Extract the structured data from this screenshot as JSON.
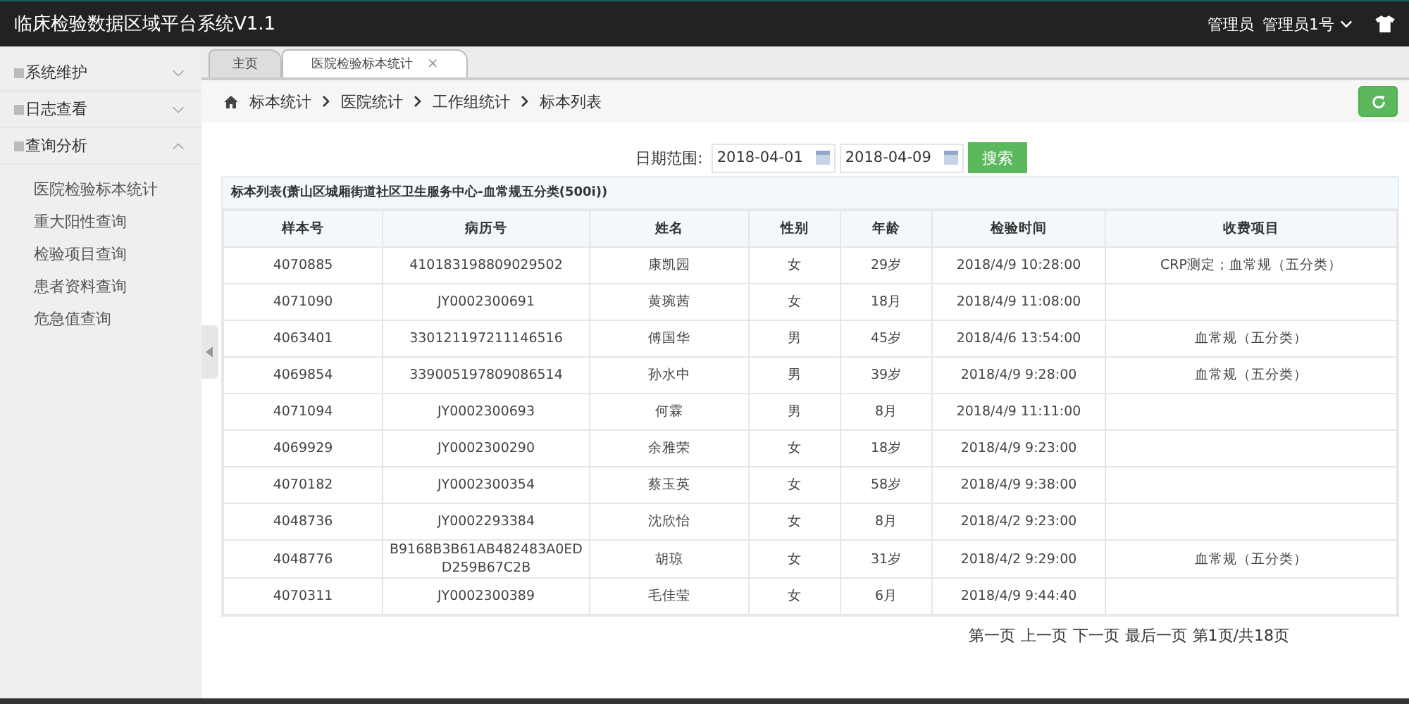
{
  "header": {
    "title": "临床检验数据区域平台系统V1.1",
    "role": "管理员",
    "user": "管理员1号"
  },
  "sidebar": {
    "groups": [
      {
        "label": "系统维护",
        "expanded": false
      },
      {
        "label": "日志查看",
        "expanded": false
      },
      {
        "label": "查询分析",
        "expanded": true,
        "children": [
          {
            "label": "医院检验标本统计"
          },
          {
            "label": "重大阳性查询"
          },
          {
            "label": "检验项目查询"
          },
          {
            "label": "患者资料查询"
          },
          {
            "label": "危急值查询"
          }
        ]
      }
    ]
  },
  "tabs": [
    {
      "label": "主页",
      "selected": false
    },
    {
      "label": "医院检验标本统计",
      "selected": true,
      "close": "×"
    }
  ],
  "breadcrumb": [
    "标本统计",
    "医院统计",
    "工作组统计",
    "标本列表"
  ],
  "filter": {
    "label": "日期范围:",
    "start": "2018-04-01",
    "end": "2018-04-09",
    "button": "搜索"
  },
  "table": {
    "caption": "标本列表(萧山区城厢街道社区卫生服务中心-血常规五分类(500i))",
    "columns": [
      "样本号",
      "病历号",
      "姓名",
      "性别",
      "年龄",
      "检验时间",
      "收费项目"
    ],
    "rows": [
      [
        "4070885",
        "410183198809029502",
        "康凯园",
        "女",
        "29岁",
        "2018/4/9 10:28:00",
        "CRP测定；血常规（五分类）"
      ],
      [
        "4071090",
        "JY0002300691",
        "黄琬茜",
        "女",
        "18月",
        "2018/4/9 11:08:00",
        ""
      ],
      [
        "4063401",
        "330121197211146516",
        "傅国华",
        "男",
        "45岁",
        "2018/4/6 13:54:00",
        "血常规（五分类）"
      ],
      [
        "4069854",
        "339005197809086514",
        "孙水中",
        "男",
        "39岁",
        "2018/4/9 9:28:00",
        "血常规（五分类）"
      ],
      [
        "4071094",
        "JY0002300693",
        "何霖",
        "男",
        "8月",
        "2018/4/9 11:11:00",
        ""
      ],
      [
        "4069929",
        "JY0002300290",
        "余雅荣",
        "女",
        "18岁",
        "2018/4/9 9:23:00",
        ""
      ],
      [
        "4070182",
        "JY0002300354",
        "蔡玉英",
        "女",
        "58岁",
        "2018/4/9 9:38:00",
        ""
      ],
      [
        "4048736",
        "JY0002293384",
        "沈欣怡",
        "女",
        "8月",
        "2018/4/2 9:23:00",
        ""
      ],
      [
        "4048776",
        "B9168B3B61AB482483A0EDD259B67C2B",
        "胡琼",
        "女",
        "31岁",
        "2018/4/2 9:29:00",
        "血常规（五分类）"
      ],
      [
        "4070311",
        "JY0002300389",
        "毛佳莹",
        "女",
        "6月",
        "2018/4/9 9:44:40",
        ""
      ]
    ]
  },
  "pagination": {
    "links": [
      "第一页",
      "上一页",
      "下一页",
      "最后一页"
    ],
    "info": "第1页/共18页"
  }
}
